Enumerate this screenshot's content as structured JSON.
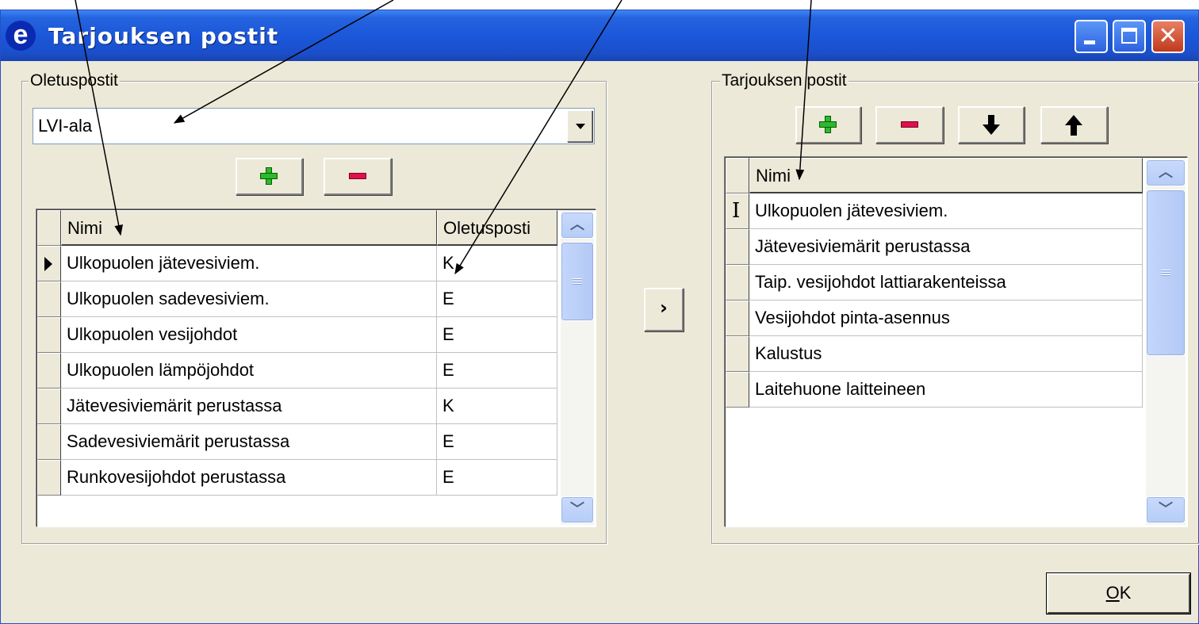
{
  "window": {
    "title": "Tarjouksen postit",
    "app_icon_glyph": "e"
  },
  "left_group": {
    "label": "Oletuspostit",
    "combo_value": "LVI-ala",
    "grid": {
      "columns": [
        "Nimi",
        "Oletusposti"
      ],
      "rows": [
        {
          "name": "Ulkopuolen jätevesiviem.",
          "default": "K",
          "current": true
        },
        {
          "name": "Ulkopuolen sadevesiviem.",
          "default": "E"
        },
        {
          "name": "Ulkopuolen vesijohdot",
          "default": "E"
        },
        {
          "name": "Ulkopuolen lämpöjohdot",
          "default": "E"
        },
        {
          "name": "Jätevesiviemärit perustassa",
          "default": "K"
        },
        {
          "name": "Sadevesiviemärit perustassa",
          "default": "E"
        },
        {
          "name": "Runkovesijohdot perustassa",
          "default": "E"
        }
      ]
    }
  },
  "transfer_button_label": "›",
  "right_group": {
    "label": "Tarjouksen postit",
    "grid": {
      "columns": [
        "Nimi"
      ],
      "rows": [
        {
          "name": "Ulkopuolen jätevesiviem.",
          "editing": true
        },
        {
          "name": "Jätevesiviemärit perustassa"
        },
        {
          "name": "Taip. vesijohdot lattiarakenteissa"
        },
        {
          "name": "Vesijohdot pinta-asennus"
        },
        {
          "name": "Kalustus"
        },
        {
          "name": "Laitehuone laitteineen"
        }
      ]
    }
  },
  "ok_button": {
    "mnemonic": "O",
    "rest": "K"
  },
  "icons": [
    "e-app-icon",
    "minimize-icon",
    "maximize-icon",
    "close-icon",
    "dropdown-arrow-icon",
    "plus-icon",
    "minus-icon",
    "arrow-down-icon",
    "arrow-up-icon",
    "row-pointer-icon",
    "text-cursor-icon",
    "scroll-up-icon",
    "scroll-down-icon"
  ],
  "colors": {
    "titlebar": "#1a56d8",
    "dialog_bg": "#ece9d8",
    "plus_icon": "#2db82d",
    "minus_icon": "#e01050",
    "close_button": "#c0391c",
    "scrollbar": "#b6cdf7"
  }
}
